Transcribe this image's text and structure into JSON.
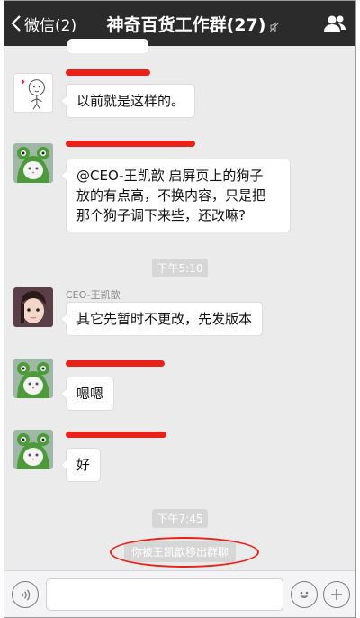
{
  "header": {
    "back_label": "微信(2)",
    "title": "神奇百货工作群(27)"
  },
  "messages": [
    {
      "type": "text",
      "sender": "",
      "sender_redacted": true,
      "avatar": "sticker-sketch",
      "text": "以前就是这样的。"
    },
    {
      "type": "text",
      "sender": "",
      "sender_redacted": true,
      "avatar": "frog-cat",
      "lines": [
        "@CEO-王凯歆 启屏页上的狗子",
        "放的有点高，不换内容，只是把",
        "那个狗子调下来些，还改嘛?"
      ]
    },
    {
      "type": "time",
      "text": "下午5:10"
    },
    {
      "type": "text",
      "sender": "CEO-王凯歆",
      "sender_redacted": false,
      "avatar": "person",
      "text": "其它先暂时不更改，先发版本"
    },
    {
      "type": "text",
      "sender": "",
      "sender_redacted": true,
      "avatar": "frog-cat",
      "text": "嗯嗯"
    },
    {
      "type": "text",
      "sender": "",
      "sender_redacted": true,
      "avatar": "frog-cat",
      "text": "好"
    },
    {
      "type": "time",
      "text": "下午7:45"
    },
    {
      "type": "system",
      "text": "你被王凯歆移出群聊"
    }
  ],
  "input": {
    "placeholder": ""
  },
  "colors": {
    "navbar": "#2b2b2b",
    "chat_bg": "#ebebeb",
    "annotation": "#e8221a"
  },
  "icons": [
    "chevron-left-icon",
    "mute-icon",
    "group-members-icon",
    "voice-icon",
    "emoji-icon",
    "plus-icon"
  ]
}
